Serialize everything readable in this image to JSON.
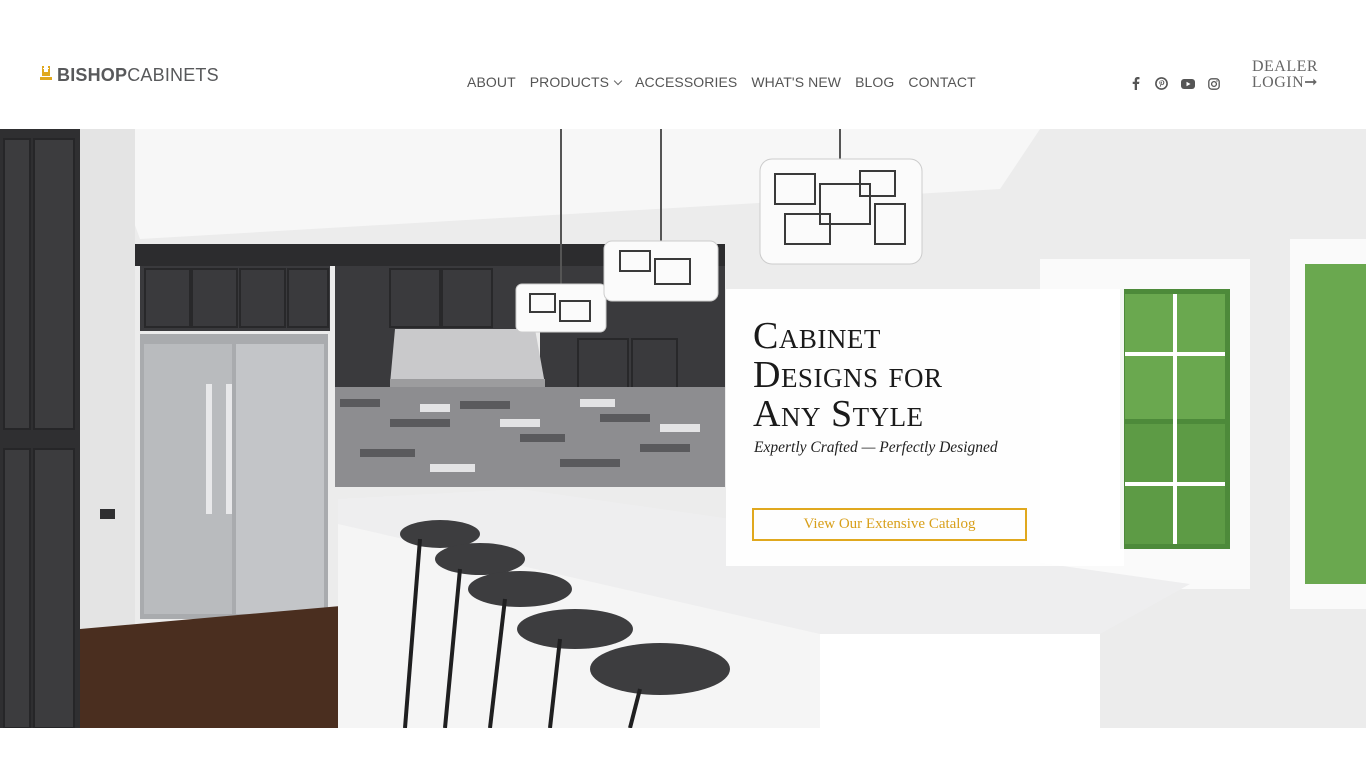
{
  "brand": {
    "name_bold": "BISHOP",
    "name_light": "CABINETS",
    "accent": "#e0a81e"
  },
  "nav": {
    "items": [
      {
        "label": "ABOUT"
      },
      {
        "label": "PRODUCTS"
      },
      {
        "label": "ACCESSORIES"
      },
      {
        "label": "WHAT'S NEW"
      },
      {
        "label": "BLOG"
      },
      {
        "label": "CONTACT"
      }
    ]
  },
  "social": [
    "facebook-icon",
    "pinterest-icon",
    "youtube-icon",
    "instagram-icon"
  ],
  "dealer": {
    "line1": "DEALER",
    "line2": "LOGIN➞"
  },
  "hero": {
    "title_line1": "Cabinet",
    "title_line2": "Designs for",
    "title_line3": "Any Style",
    "subtitle": "Expertly Crafted — Perfectly Designed",
    "cta": "View Our Extensive Catalog"
  }
}
